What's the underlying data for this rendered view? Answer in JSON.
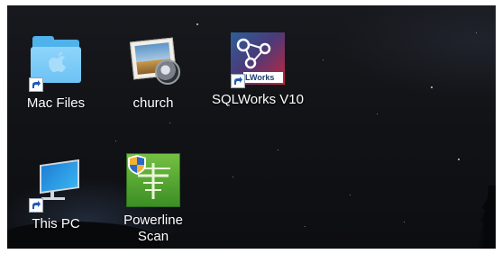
{
  "desktop": {
    "partial_top_label": "",
    "icons": [
      {
        "label": "Mac Files",
        "kind": "folder"
      },
      {
        "label": "church",
        "kind": "photo"
      },
      {
        "label": "SQLWorks V10",
        "kind": "app",
        "badge_text": "LWorks"
      },
      {
        "label": "This PC",
        "kind": "computer"
      },
      {
        "label": "Powerline Scan",
        "kind": "app"
      }
    ]
  },
  "colors": {
    "folder": "#4fb2ea",
    "sql_left": "#2c5f98",
    "sql_right": "#c5243a",
    "powerline": "#3c8f25",
    "label_text": "#ffffff"
  },
  "icons_semantic": [
    "folder-icon",
    "photo-icon",
    "sqlworks-icon",
    "computer-icon",
    "powerline-icon",
    "shortcut-arrow-icon"
  ]
}
